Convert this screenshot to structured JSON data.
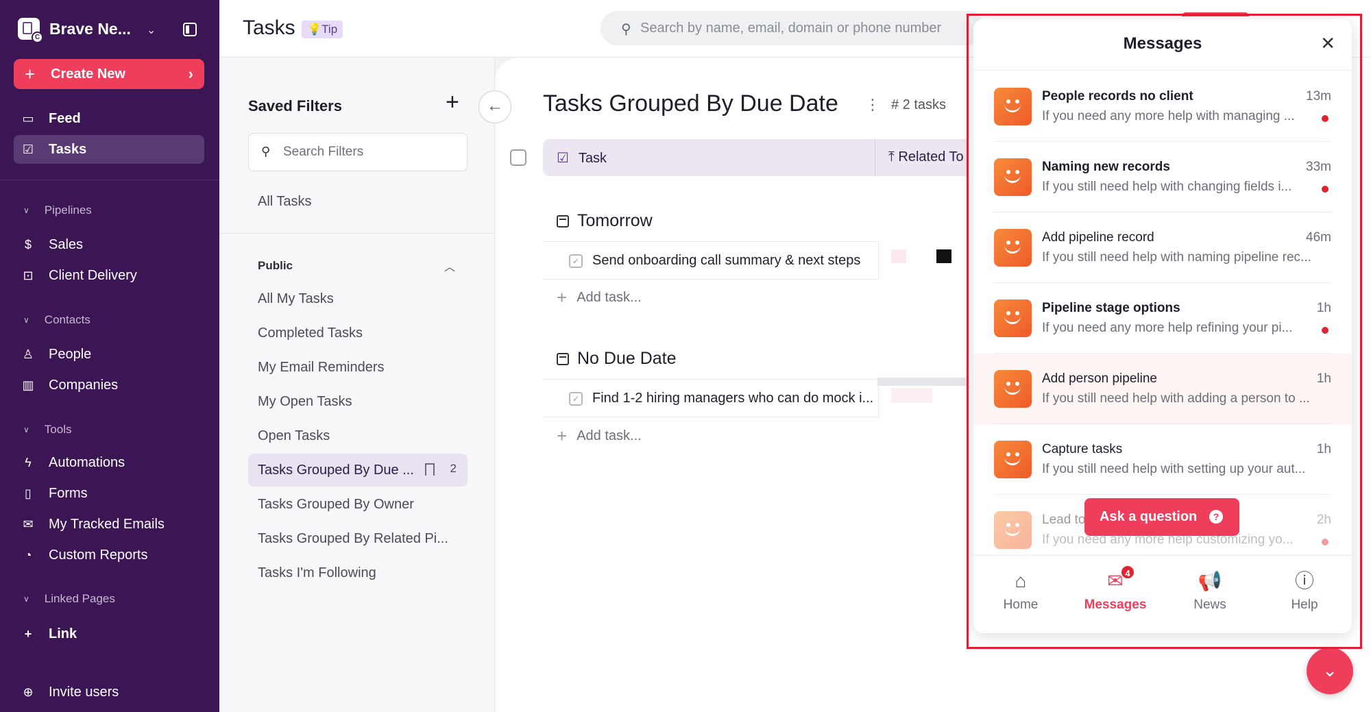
{
  "workspace": {
    "name": "Brave Ne...",
    "badge": "C"
  },
  "create_new": {
    "label": "Create New",
    "plus": "+",
    "arrow": "›"
  },
  "nav": {
    "feed": "Feed",
    "tasks": "Tasks",
    "pipelines_section": "Pipelines",
    "sales": "Sales",
    "client_delivery": "Client Delivery",
    "contacts_section": "Contacts",
    "people": "People",
    "companies": "Companies",
    "tools_section": "Tools",
    "automations": "Automations",
    "forms": "Forms",
    "tracked_emails": "My Tracked Emails",
    "custom_reports": "Custom Reports",
    "linked_pages_section": "Linked Pages",
    "link": "Link",
    "invite_users": "Invite users"
  },
  "header": {
    "title": "Tasks",
    "tip": "💡Tip",
    "search_placeholder": "Search by name, email, domain or phone number"
  },
  "filters": {
    "title": "Saved Filters",
    "add": "+",
    "search_placeholder": "Search Filters",
    "all_tasks": "All Tasks",
    "public_label": "Public",
    "items": [
      "All My Tasks",
      "Completed Tasks",
      "My Email Reminders",
      "My Open Tasks",
      "Open Tasks",
      "Tasks Grouped By Due ...",
      "Tasks Grouped By Owner",
      "Tasks Grouped By Related Pi...",
      "Tasks I'm Following"
    ],
    "selected_count": "2"
  },
  "main": {
    "title": "Tasks Grouped By Due Date",
    "count": "# 2 tasks",
    "col_task": "Task",
    "col_related": "Related To",
    "groups": [
      {
        "name": "Tomorrow",
        "task": "Send onboarding call summary & next steps",
        "add": "Add task..."
      },
      {
        "name": "No Due Date",
        "task": "Find 1-2 hiring managers who can do mock i...",
        "add": "Add task..."
      }
    ]
  },
  "messenger": {
    "title": "Messages",
    "messages": [
      {
        "title": "People records no client",
        "time": "13m",
        "preview": "If you need any more help with managing ...",
        "unread": true
      },
      {
        "title": "Naming new records",
        "time": "33m",
        "preview": "If you still need help with changing fields i...",
        "unread": true
      },
      {
        "title": "Add pipeline record",
        "time": "46m",
        "preview": "If you still need help with naming pipeline rec...",
        "unread": false
      },
      {
        "title": "Pipeline stage options",
        "time": "1h",
        "preview": "If you need any more help refining your pi...",
        "unread": true
      },
      {
        "title": "Add person pipeline",
        "time": "1h",
        "preview": "If you still need help with adding a person to ...",
        "unread": false
      },
      {
        "title": "Capture tasks",
        "time": "1h",
        "preview": "If you still need help with setting up your aut...",
        "unread": false
      },
      {
        "title": "Lead to",
        "time": "2h",
        "preview": "If you need any more help customizing yo...",
        "unread": true
      }
    ],
    "ask_button": "Ask a question",
    "tabs": {
      "home": "Home",
      "messages": "Messages",
      "news": "News",
      "help": "Help"
    },
    "badge_count": "4"
  },
  "colors": {
    "sidebar": "#3c1654",
    "accent": "#ef3e5c",
    "highlight_box": "#e31d33"
  }
}
